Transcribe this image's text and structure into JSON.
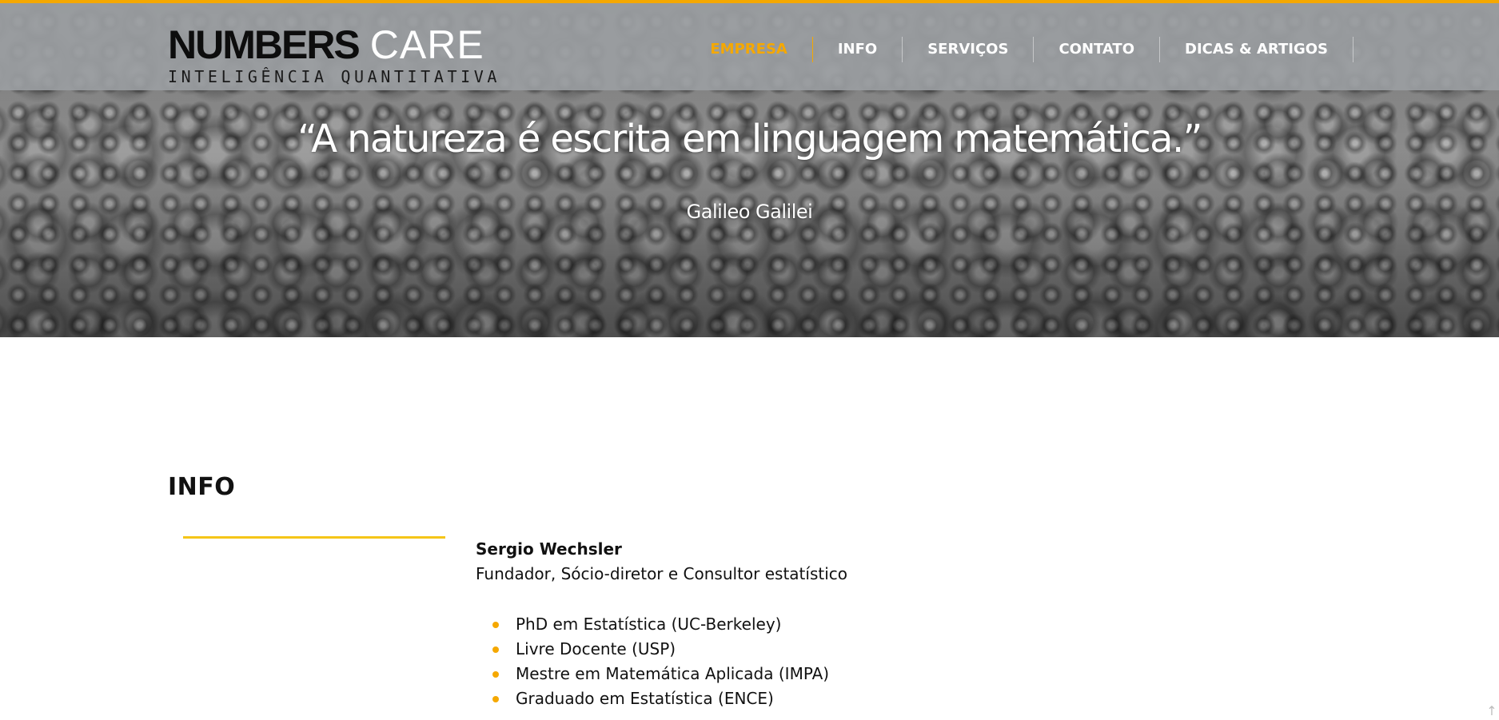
{
  "header": {
    "logo": {
      "numbers": "NUMBERS",
      "care": "CARE",
      "tagline": "INTELIGÊNCIA QUANTITATIVA"
    },
    "nav": [
      {
        "label": "EMPRESA",
        "active": true
      },
      {
        "label": "INFO",
        "active": false
      },
      {
        "label": "SERVIÇOS",
        "active": false
      },
      {
        "label": "CONTATO",
        "active": false
      },
      {
        "label": "DICAS & ARTIGOS",
        "active": false
      }
    ],
    "accent_color": "#f5a800"
  },
  "hero": {
    "quote": "“A natureza é escrita em linguagem matemática.”",
    "author": "Galileo Galilei"
  },
  "info": {
    "title": "INFO",
    "person_name": "Sergio Wechsler",
    "person_role": "Fundador, Sócio-diretor e Consultor estatístico",
    "credentials": [
      "PhD em Estatística (UC-Berkeley)",
      "Livre Docente (USP)",
      "Mestre em Matemática Aplicada (IMPA)",
      "Graduado em Estatística (ENCE)"
    ]
  },
  "icons": {
    "scroll_top": "arrow-up-icon"
  }
}
